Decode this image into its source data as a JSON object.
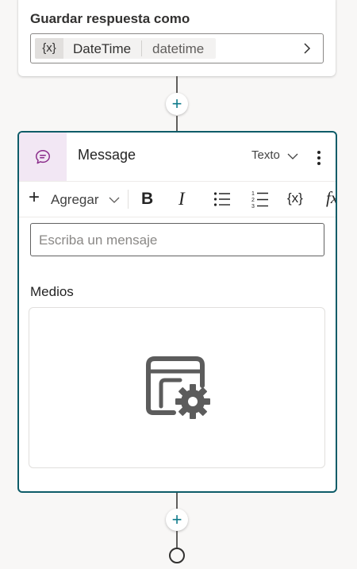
{
  "save_response": {
    "label": "Guardar respuesta como",
    "variable_icon_text": "{x}",
    "variable_name": "DateTime",
    "variable_type": "datetime"
  },
  "connector": {
    "add_symbol": "+"
  },
  "message_node": {
    "title": "Message",
    "format_select": "Texto",
    "toolbar": {
      "add_symbol": "+",
      "add_label": "Agregar",
      "bold": "B",
      "italic": "I",
      "variable": "{x}",
      "formula": "fx"
    },
    "message_placeholder": "Escriba un mensaje",
    "media_label": "Medios"
  },
  "icons": {
    "variable": "variable-braces-icon",
    "chevron_right": "chevron-right-icon",
    "message": "chat-bubble-icon",
    "chevron_down": "chevron-down-icon",
    "more": "more-vertical-icon",
    "bullet_list": "bullet-list-icon",
    "numbered_list": "numbered-list-icon",
    "media_settings": "media-settings-icon",
    "end": "end-node-icon"
  },
  "colors": {
    "accent_teal": "#0e7a8a",
    "card_border": "#0e5c68",
    "message_icon_bg": "#f2e7f4",
    "message_icon": "#8a2b8a"
  }
}
